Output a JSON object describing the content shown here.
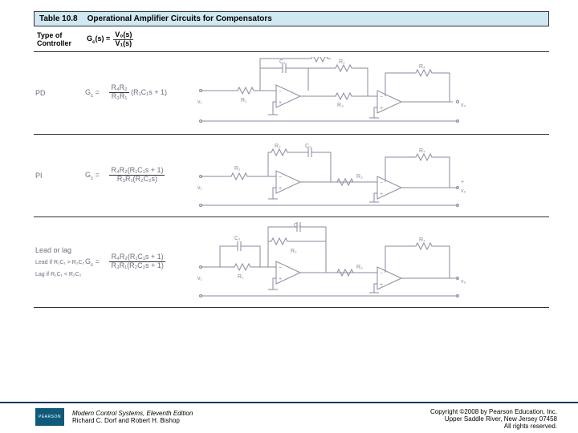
{
  "header": {
    "table_num": "Table 10.8",
    "title": "Operational Amplifier Circuits for Compensators"
  },
  "columns": {
    "c1a": "Type of",
    "c1b": "Controller",
    "gc_label": "G",
    "gc_sub": "c",
    "gc_arg": "(s) ="
  },
  "tf_header": {
    "num": "V₀(s)",
    "den": "V₁(s)"
  },
  "rows": [
    {
      "type": "PD",
      "gc": "G",
      "sub": "c",
      "eq_n": "R₄R₂",
      "eq_d": "R₃R₁",
      "tail": "(R₁C₁s + 1)"
    },
    {
      "type": "PI",
      "gc": "G",
      "sub": "c",
      "eq_n": "R₄R₂(R₁C₁s + 1)",
      "eq_d": "R₃R₁(R₂C₂s)"
    },
    {
      "type": "Lead or lag",
      "gc": "G",
      "sub": "c",
      "eq_n": "R₄R₂(R₁C₁s + 1)",
      "eq_d": "R₃R₁(R₂C₂s + 1)",
      "cond1": "Lead if R₁C₁ > R₂C₂",
      "cond2": "Lag if R₁C₁ < R₂C₂"
    }
  ],
  "labels": {
    "C1": "C₁",
    "C2": "C₂",
    "R1": "R₁",
    "R2": "R₂",
    "R3": "R₃",
    "R4": "R₄",
    "v1": "v₁",
    "v0": "v₀",
    "plus": "+",
    "minus": "−"
  },
  "footer": {
    "book1": "Modern Control Systems, Eleventh Edition",
    "book2": "Richard C. Dorf and Robert H. Bishop",
    "logo": "PEARSON",
    "c1": "Copyright ©2008 by Pearson Education, Inc.",
    "c2": "Upper Saddle River, New Jersey 07458",
    "c3": "All rights reserved."
  }
}
